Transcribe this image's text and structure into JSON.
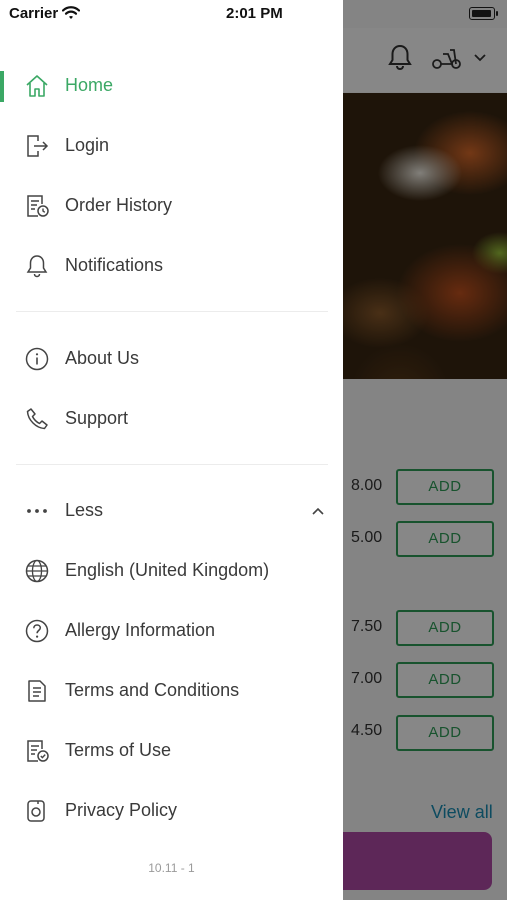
{
  "status_bar": {
    "carrier": "Carrier",
    "time": "2:01 PM"
  },
  "menu": {
    "primary": [
      {
        "label": "Home",
        "icon": "home-icon",
        "active": true
      },
      {
        "label": "Login",
        "icon": "login-icon"
      },
      {
        "label": "Order History",
        "icon": "order-history-icon"
      },
      {
        "label": "Notifications",
        "icon": "bell-icon"
      }
    ],
    "secondary": [
      {
        "label": "About Us",
        "icon": "info-icon"
      },
      {
        "label": "Support",
        "icon": "phone-icon"
      }
    ],
    "more": {
      "label": "Less",
      "icon": "more-dots-icon",
      "toggle_icon": "chevron-up-icon"
    },
    "extra": [
      {
        "label": "English (United Kingdom)",
        "icon": "globe-icon"
      },
      {
        "label": "Allergy Information",
        "icon": "question-icon"
      },
      {
        "label": "Terms and Conditions",
        "icon": "document-icon"
      },
      {
        "label": "Terms of Use",
        "icon": "document-check-icon"
      },
      {
        "label": "Privacy Policy",
        "icon": "privacy-icon"
      }
    ],
    "version": "10.11 - 1"
  },
  "background": {
    "prices": [
      "8.00",
      "5.00",
      "7.50",
      "7.00",
      "4.50"
    ],
    "add_label": "ADD",
    "view_all": "View all",
    "accent": "#3ba865",
    "add_color": "#2f9d58",
    "link_color": "#1a8fb6",
    "cart_color": "#b04aa6"
  }
}
